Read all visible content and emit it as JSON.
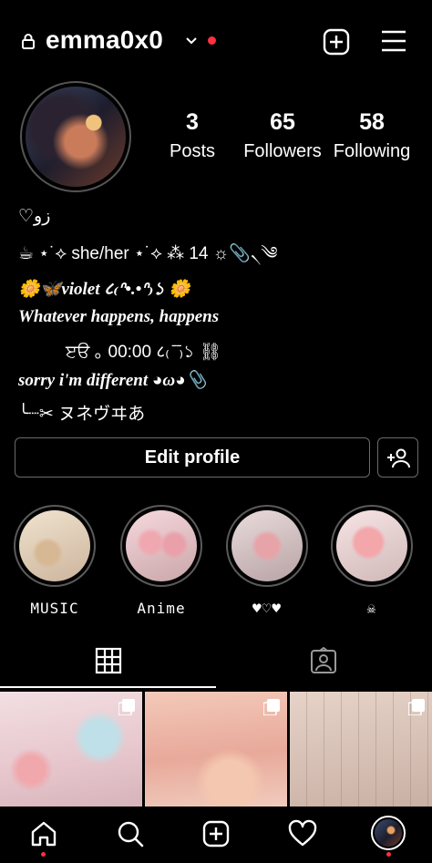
{
  "header": {
    "username": "emma0x0",
    "lock_icon": "lock-icon",
    "chevron_icon": "chevron-down-icon",
    "notification_color": "#ff3040",
    "create_icon": "plus-square-icon",
    "menu_icon": "hamburger-menu-icon"
  },
  "stats": {
    "posts_count": "3",
    "posts_label": "Posts",
    "followers_count": "65",
    "followers_label": "Followers",
    "following_count": "58",
    "following_label": "Following"
  },
  "bio": {
    "line1": "♡زو",
    "line2": "☕ ⋆˙⟡ she/her ⋆˙⟡ ⁂ 14 ☼📎৲༄",
    "line3": "🌼🦋violet ८₍ᐢ•.•ᐢ₎১ 🌼",
    "line4": "Whatever happens, happens",
    "line5": "ੲੳ ｡ 00:00 ८₍ ̄ ̄₎১ ⛓",
    "line6": "sorry i'm different ◕ω◕📎",
    "line7": "╰┈✂ ヌネヴヰあ"
  },
  "actions": {
    "edit_profile": "Edit profile",
    "add_user_icon": "add-person-icon"
  },
  "highlights": [
    {
      "label": "MUSIC"
    },
    {
      "label": "Anime"
    },
    {
      "label": "♥♡♥"
    },
    {
      "label": "☠"
    }
  ],
  "tabs": {
    "grid_icon": "grid-icon",
    "tagged_icon": "tagged-person-icon",
    "active": "grid"
  },
  "nav": {
    "items": [
      "home-icon",
      "search-icon",
      "create-icon",
      "heart-icon",
      "profile-avatar"
    ],
    "accent": "#ff3040"
  }
}
